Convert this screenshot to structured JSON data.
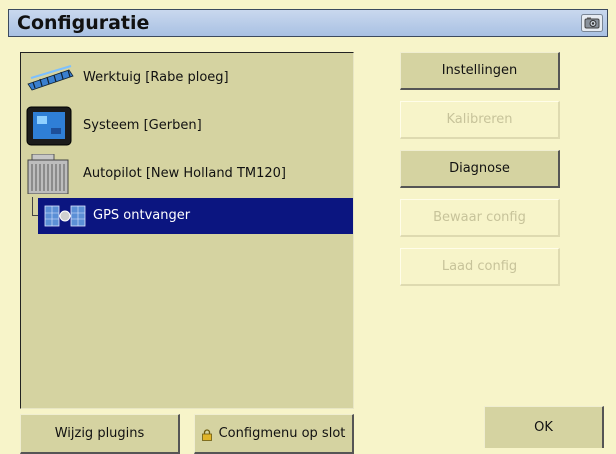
{
  "window": {
    "title": "Configuratie",
    "title_icon": "camera-icon"
  },
  "tree": {
    "nodes": [
      {
        "label": "Werktuig [Rabe ploeg]",
        "icon": "implement-icon"
      },
      {
        "label": "Systeem [Gerben]",
        "icon": "display-terminal-icon"
      },
      {
        "label": "Autopilot [New Holland TM120]",
        "icon": "autopilot-module-icon"
      },
      {
        "label": "GPS ontvanger",
        "icon": "satellite-icon",
        "selected": true
      }
    ]
  },
  "actions": {
    "instellingen": "Instellingen",
    "kalibreren": "Kalibreren",
    "diagnose": "Diagnose",
    "bewaar": "Bewaar config",
    "laad": "Laad config"
  },
  "footer": {
    "plugins": "Wijzig plugins",
    "lock": "Configmenu op slot",
    "ok": "OK"
  },
  "colors": {
    "selection": "#0b1580",
    "panel": "#d5d3a1",
    "background": "#f7f4c9",
    "title_bar": "#b7cbe8"
  }
}
